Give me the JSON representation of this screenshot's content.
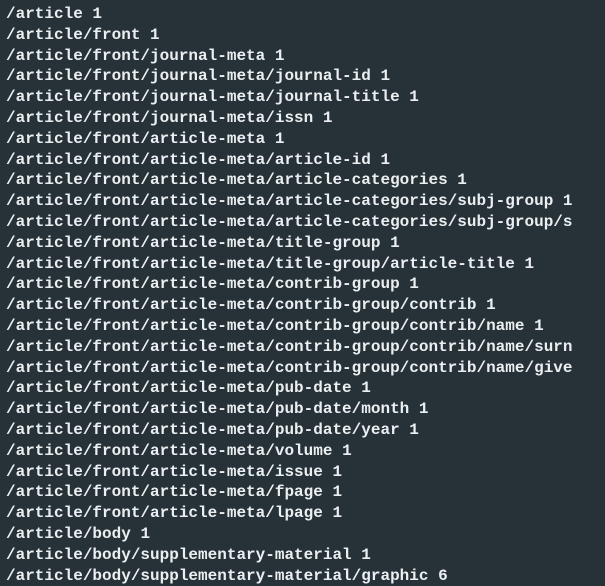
{
  "lines": [
    {
      "path": "/article",
      "count": "1"
    },
    {
      "path": "/article/front",
      "count": "1"
    },
    {
      "path": "/article/front/journal-meta",
      "count": "1"
    },
    {
      "path": "/article/front/journal-meta/journal-id",
      "count": "1"
    },
    {
      "path": "/article/front/journal-meta/journal-title",
      "count": "1"
    },
    {
      "path": "/article/front/journal-meta/issn",
      "count": "1"
    },
    {
      "path": "/article/front/article-meta",
      "count": "1"
    },
    {
      "path": "/article/front/article-meta/article-id",
      "count": "1"
    },
    {
      "path": "/article/front/article-meta/article-categories",
      "count": "1"
    },
    {
      "path": "/article/front/article-meta/article-categories/subj-group",
      "count": "1"
    },
    {
      "path": "/article/front/article-meta/article-categories/subj-group/s",
      "count": ""
    },
    {
      "path": "/article/front/article-meta/title-group",
      "count": "1"
    },
    {
      "path": "/article/front/article-meta/title-group/article-title",
      "count": "1"
    },
    {
      "path": "/article/front/article-meta/contrib-group",
      "count": "1"
    },
    {
      "path": "/article/front/article-meta/contrib-group/contrib",
      "count": "1"
    },
    {
      "path": "/article/front/article-meta/contrib-group/contrib/name",
      "count": "1"
    },
    {
      "path": "/article/front/article-meta/contrib-group/contrib/name/surn",
      "count": ""
    },
    {
      "path": "/article/front/article-meta/contrib-group/contrib/name/give",
      "count": ""
    },
    {
      "path": "/article/front/article-meta/pub-date",
      "count": "1"
    },
    {
      "path": "/article/front/article-meta/pub-date/month",
      "count": "1"
    },
    {
      "path": "/article/front/article-meta/pub-date/year",
      "count": "1"
    },
    {
      "path": "/article/front/article-meta/volume",
      "count": "1"
    },
    {
      "path": "/article/front/article-meta/issue",
      "count": "1"
    },
    {
      "path": "/article/front/article-meta/fpage",
      "count": "1"
    },
    {
      "path": "/article/front/article-meta/lpage",
      "count": "1"
    },
    {
      "path": "/article/body",
      "count": "1"
    },
    {
      "path": "/article/body/supplementary-material",
      "count": "1"
    },
    {
      "path": "/article/body/supplementary-material/graphic",
      "count": "6"
    }
  ]
}
